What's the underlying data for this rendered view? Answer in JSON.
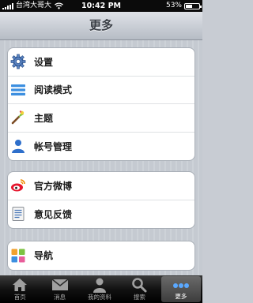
{
  "status_bar": {
    "carrier": "台湾大哥大",
    "time": "10:42 PM",
    "battery": "53%",
    "battery_level": 0.53
  },
  "nav": {
    "title": "更多"
  },
  "groups": [
    {
      "items": [
        {
          "label": "设置",
          "icon": "gear-icon"
        },
        {
          "label": "阅读模式",
          "icon": "reading-mode-icon"
        },
        {
          "label": "主题",
          "icon": "theme-brush-icon"
        },
        {
          "label": "帐号管理",
          "icon": "person-icon"
        }
      ]
    },
    {
      "items": [
        {
          "label": "官方微博",
          "icon": "weibo-icon"
        },
        {
          "label": "意见反馈",
          "icon": "document-icon"
        }
      ]
    },
    {
      "items": [
        {
          "label": "导航",
          "icon": "grid-icon"
        }
      ]
    }
  ],
  "tab_bar": {
    "tabs": [
      {
        "label": "首页",
        "icon": "home-icon",
        "active": false
      },
      {
        "label": "消息",
        "icon": "envelope-icon",
        "active": false
      },
      {
        "label": "我的资料",
        "icon": "person-icon",
        "active": false
      },
      {
        "label": "搜索",
        "icon": "search-icon",
        "active": false
      },
      {
        "label": "更多",
        "icon": "more-icon",
        "active": true
      }
    ]
  },
  "colors": {
    "blue_icon": "#2e6fcb",
    "weibo_red": "#e6162d",
    "tab_active_dots": "#5aa8ff"
  }
}
